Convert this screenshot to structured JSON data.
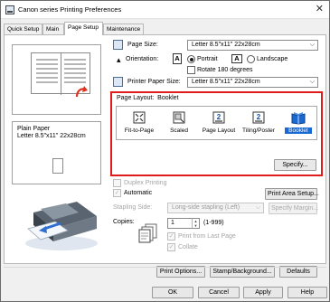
{
  "window": {
    "title": "Canon           series Printing Preferences",
    "close_glyph": "✕"
  },
  "tabs": [
    {
      "label": "Quick Setup",
      "active": false
    },
    {
      "label": "Main",
      "active": false
    },
    {
      "label": "Page Setup",
      "active": true
    },
    {
      "label": "Maintenance",
      "active": false
    }
  ],
  "preview": {
    "media_line1": "Plain Paper",
    "media_line2": "Letter 8.5\"x11\" 22x28cm"
  },
  "page_setup": {
    "page_size_label": "Page Size:",
    "page_size_value": "Letter 8.5\"x11\" 22x28cm",
    "orientation_label": "Orientation:",
    "orientation_icon_glyph": "A",
    "portrait_label": "Portrait",
    "landscape_label": "Landscape",
    "orientation_selected": "Portrait",
    "rotate_label": "Rotate 180 degrees",
    "rotate_checked": false,
    "printer_paper_size_label": "Printer Paper Size:",
    "printer_paper_size_value": "Letter 8.5\"x11\" 22x28cm"
  },
  "page_layout": {
    "label": "Page Layout:",
    "value": "Booklet",
    "options": [
      {
        "label": "Fit-to-Page",
        "selected": false,
        "icon": "fit-to-page-icon"
      },
      {
        "label": "Scaled",
        "selected": false,
        "icon": "scaled-icon"
      },
      {
        "label": "Page Layout",
        "selected": false,
        "icon": "page-layout-icon",
        "glyph": "2"
      },
      {
        "label": "Tiling/Poster",
        "selected": false,
        "icon": "tiling-poster-icon",
        "glyph": "2"
      },
      {
        "label": "Booklet",
        "selected": true,
        "icon": "booklet-icon"
      }
    ],
    "specify_label": "Specify..."
  },
  "duplex": {
    "duplex_label": "Duplex Printing",
    "duplex_checked": false,
    "duplex_enabled": false,
    "automatic_label": "Automatic",
    "automatic_checked": true,
    "print_area_setup_label": "Print Area Setup...",
    "stapling_side_label": "Stapling Side:",
    "stapling_side_value": "Long-side stapling (Left)",
    "specify_margin_label": "Specify Margin..."
  },
  "copies": {
    "label": "Copies:",
    "value": "1",
    "range": "(1-999)",
    "print_from_last_label": "Print from Last Page",
    "print_from_last_checked": true,
    "collate_label": "Collate",
    "collate_checked": true
  },
  "bottom_buttons": {
    "print_options": "Print Options...",
    "stamp_background": "Stamp/Background...",
    "defaults": "Defaults"
  },
  "dialog_buttons": {
    "ok": "OK",
    "cancel": "Cancel",
    "apply": "Apply",
    "help": "Help"
  },
  "colors": {
    "highlight": "#e01b1b",
    "selection": "#1a68d1"
  },
  "check_glyph": "✓",
  "chevron_glyph": "⌵",
  "spin_up": "▲",
  "spin_down": "▼"
}
